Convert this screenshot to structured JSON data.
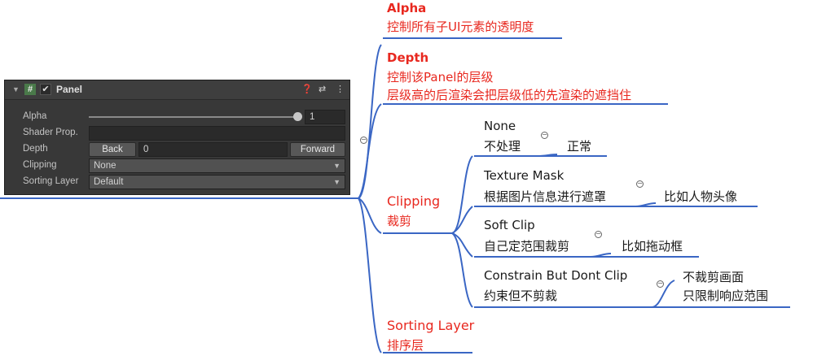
{
  "panel": {
    "title": "Panel",
    "hash_icon": "#",
    "check_icon": "✔",
    "rows": {
      "alpha_label": "Alpha",
      "alpha_value": "1",
      "shader_label": "Shader Prop.",
      "depth_label": "Depth",
      "depth_back": "Back",
      "depth_value": "0",
      "depth_forward": "Forward",
      "clipping_label": "Clipping",
      "clipping_value": "None",
      "sorting_label": "Sorting Layer",
      "sorting_value": "Default"
    }
  },
  "mindmap": {
    "alpha": {
      "title": "Alpha",
      "desc": "控制所有子UI元素的透明度"
    },
    "depth": {
      "title": "Depth",
      "desc1": "控制该Panel的层级",
      "desc2": "层级高的后渲染会把层级低的先渲染的遮挡住"
    },
    "clipping": {
      "title": "Clipping",
      "desc": "裁剪",
      "children": [
        {
          "title": "None",
          "desc": "不处理",
          "note": "正常"
        },
        {
          "title": "Texture Mask",
          "desc": "根据图片信息进行遮罩",
          "note": "比如人物头像"
        },
        {
          "title": "Soft Clip",
          "desc": "自己定范围裁剪",
          "note": "比如拖动框"
        },
        {
          "title": "Constrain But Dont Clip",
          "desc": "约束但不剪裁",
          "note1": "不裁剪画面",
          "note2": "只限制响应范围"
        }
      ]
    },
    "sorting": {
      "title": "Sorting Layer",
      "desc": "排序层"
    }
  },
  "colors": {
    "accent_red": "#e8281f",
    "line_blue": "#3a66c4",
    "panel_bg": "#383838"
  }
}
